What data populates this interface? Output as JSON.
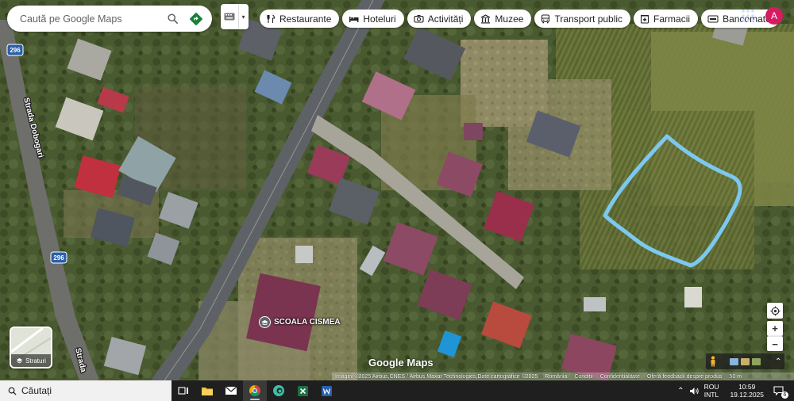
{
  "search": {
    "placeholder": "Caută pe Google Maps"
  },
  "categories": [
    {
      "label": "Restaurante",
      "icon": "cutlery-icon"
    },
    {
      "label": "Hoteluri",
      "icon": "bed-icon"
    },
    {
      "label": "Activități",
      "icon": "camera-icon"
    },
    {
      "label": "Muzee",
      "icon": "museum-icon"
    },
    {
      "label": "Transport public",
      "icon": "bus-icon"
    },
    {
      "label": "Farmacii",
      "icon": "pharmacy-icon"
    },
    {
      "label": "Bancomate",
      "icon": "atm-icon"
    }
  ],
  "account": {
    "initial": "A",
    "color": "#d81b60"
  },
  "map": {
    "streets": [
      "Strada Dobogari",
      "Strada"
    ],
    "road_badges": [
      "296",
      "296"
    ],
    "place_label": "SCOALA CISMEA",
    "logo": "Google Maps",
    "highlight_color": "#7cc8f0"
  },
  "layers": {
    "label": "Straturi"
  },
  "attribution": [
    "Imagini ©2025 Airbus,CNES / Airbus,Maxar Technologies,Date cartografice ©2025",
    "România",
    "Condiții",
    "Confidențialitate",
    "Oferă feedback despre produs",
    "50 m"
  ],
  "taskbar": {
    "search_label": "Căutați",
    "lang1": "ROU",
    "lang2": "INTL",
    "time": "10:59",
    "date": "19.12.2025",
    "notifications": "6"
  }
}
